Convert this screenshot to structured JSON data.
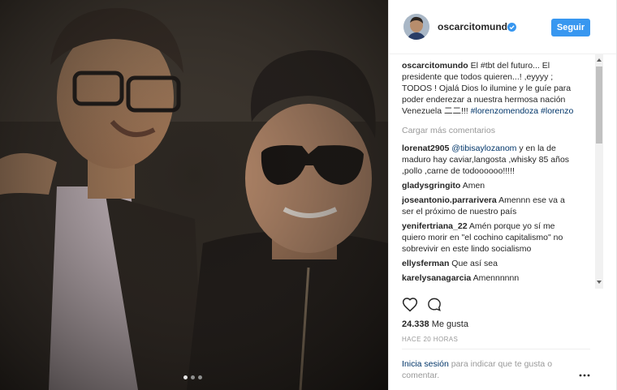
{
  "post": {
    "username": "oscarcitomundo",
    "follow_label": "Seguir",
    "caption_user": "oscarcitomundo",
    "caption_text": "El #tbt del futuro... El presidente que todos quieren...! ,eyyyy ; TODOS ! Ojalá Dios lo ilumine y le guíe para poder enderezar a nuestra hermosa nación Venezuela 二二!!! ",
    "caption_tags": "#lorenzomendoza #lorenzo",
    "load_more": "Cargar más comentarios",
    "comments": [
      {
        "user": "lorenat2905",
        "mention": "@tibisaylozanom",
        "text": " y en la de maduro hay caviar,langosta ,whisky 85 años ,pollo ,carne de todoooooo!!!!!"
      },
      {
        "user": "gladysgringito",
        "text": "Amen"
      },
      {
        "user": "joseantonio.parrarivera",
        "text": "Amennn ese va a ser el próximo de nuestro país"
      },
      {
        "user": "yenifertriana_22",
        "text": "Amén porque yo sí me quiero morir en \"el cochino capitalismo\" no sobrevivir en este lindo socialismo"
      },
      {
        "user": "ellysferman",
        "text": "Que así sea"
      },
      {
        "user": "karelysanagarcia",
        "text": "Amennnnnn"
      }
    ],
    "likes_count": "24.338",
    "likes_label": "Me gusta",
    "time_ago": "HACE 20 HORAS",
    "login_link": "Inicia sesión",
    "login_text": " para indicar que te gusta o comentar.",
    "options_glyph": "o o o",
    "carousel": {
      "count": 3,
      "active": 0
    },
    "colors": {
      "accent": "#3897f0",
      "link": "#003569",
      "muted": "#999999"
    }
  }
}
